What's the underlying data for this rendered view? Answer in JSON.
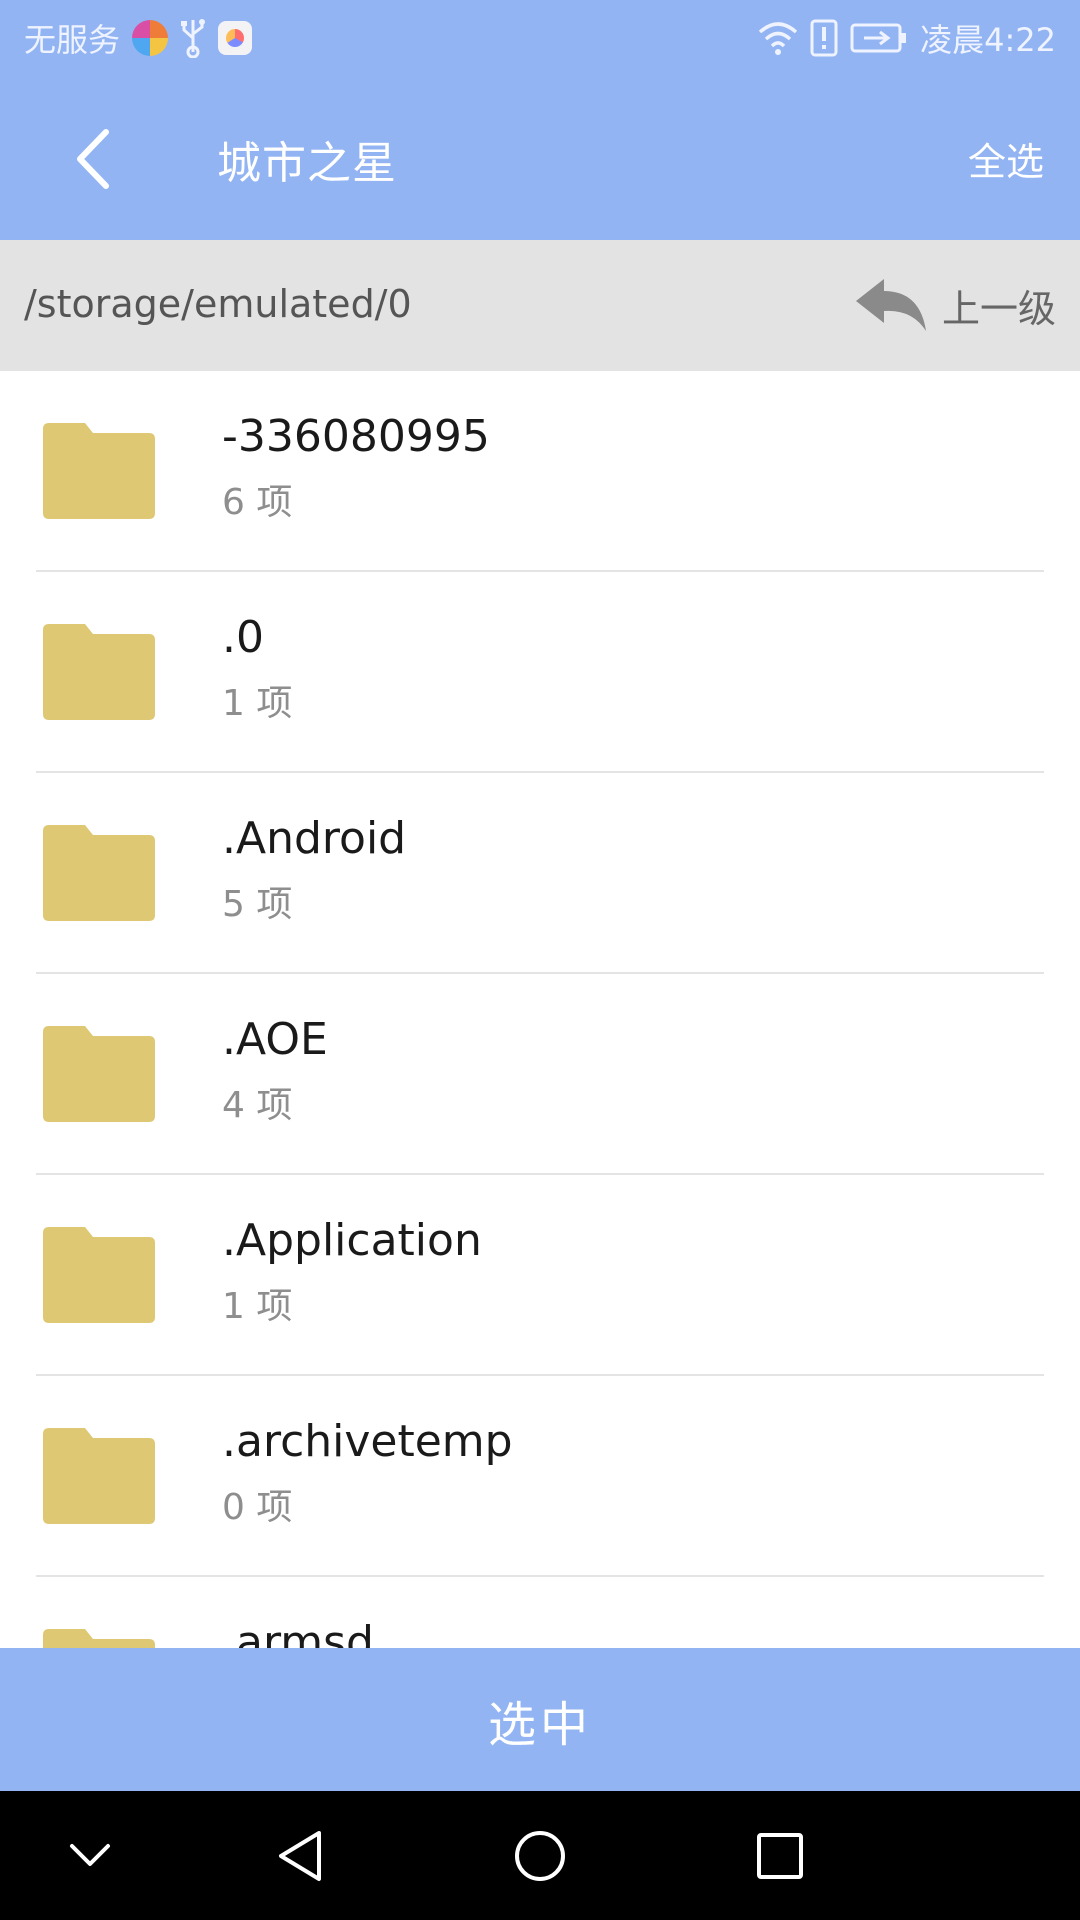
{
  "status_bar": {
    "carrier": "无服务",
    "time": "凌晨4:22",
    "icons": [
      "browser-app-icon",
      "usb-icon",
      "app-icon",
      "wifi-icon",
      "alert-icon",
      "battery-charging-icon"
    ]
  },
  "toolbar": {
    "title": "城市之星",
    "select_all": "全选"
  },
  "pathbar": {
    "path": "/storage/emulated/0",
    "up_label": "上一级"
  },
  "folders": [
    {
      "name": "-336080995",
      "count": "6 项"
    },
    {
      "name": ".0",
      "count": "1 项"
    },
    {
      "name": ".Android",
      "count": "5 项"
    },
    {
      "name": ".AOE",
      "count": "4 项"
    },
    {
      "name": ".Application",
      "count": "1 项"
    },
    {
      "name": ".archivetemp",
      "count": "0 项"
    },
    {
      "name": ".armsd",
      "count": ""
    }
  ],
  "bottom": {
    "select_label": "选中"
  },
  "colors": {
    "accent": "#93b4f3",
    "folder": "#dfc873",
    "pathbar_bg": "#e3e3e3"
  }
}
